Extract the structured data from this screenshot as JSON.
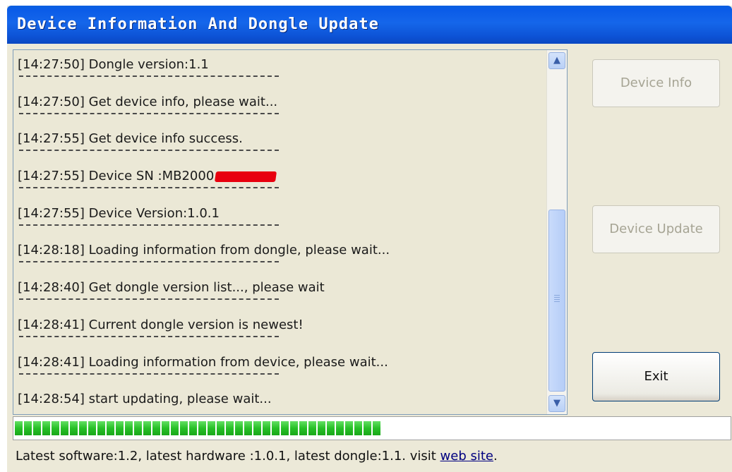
{
  "window": {
    "title": "Device Information And Dongle Update"
  },
  "log": {
    "entries": [
      {
        "time": "[14:27:50]",
        "message": "Dongle version:1.1"
      },
      {
        "time": "[14:27:50]",
        "message": "Get device info, please wait..."
      },
      {
        "time": "[14:27:55]",
        "message": "Get device info success."
      },
      {
        "time": "[14:27:55]",
        "message": "Device SN    :MB2000"
      },
      {
        "time": "[14:27:55]",
        "message": "Device Version:1.0.1"
      },
      {
        "time": "[14:28:18]",
        "message": "Loading information from dongle, please wait..."
      },
      {
        "time": "[14:28:40]",
        "message": "Get dongle version list..., please wait"
      },
      {
        "time": "[14:28:41]",
        "message": "Current dongle version is newest!"
      },
      {
        "time": "[14:28:41]",
        "message": "Loading information from device, please wait..."
      },
      {
        "time": "[14:28:54]",
        "message": "start updating, please wait..."
      }
    ]
  },
  "buttons": {
    "device_info": "Device Info",
    "device_update": "Device Update",
    "exit": "Exit"
  },
  "progress": {
    "fraction": 0.52
  },
  "status": {
    "text": "Latest software:1.2, latest hardware :1.0.1, latest dongle:1.1. visit ",
    "link": "web site",
    "suffix": "."
  },
  "colors": {
    "title_bar": "#0b5ce8",
    "progress_fill": "#27c027",
    "redaction": "#e8000e"
  },
  "icons": {
    "scroll_up": "chevron-up-icon",
    "scroll_down": "chevron-down-icon"
  }
}
